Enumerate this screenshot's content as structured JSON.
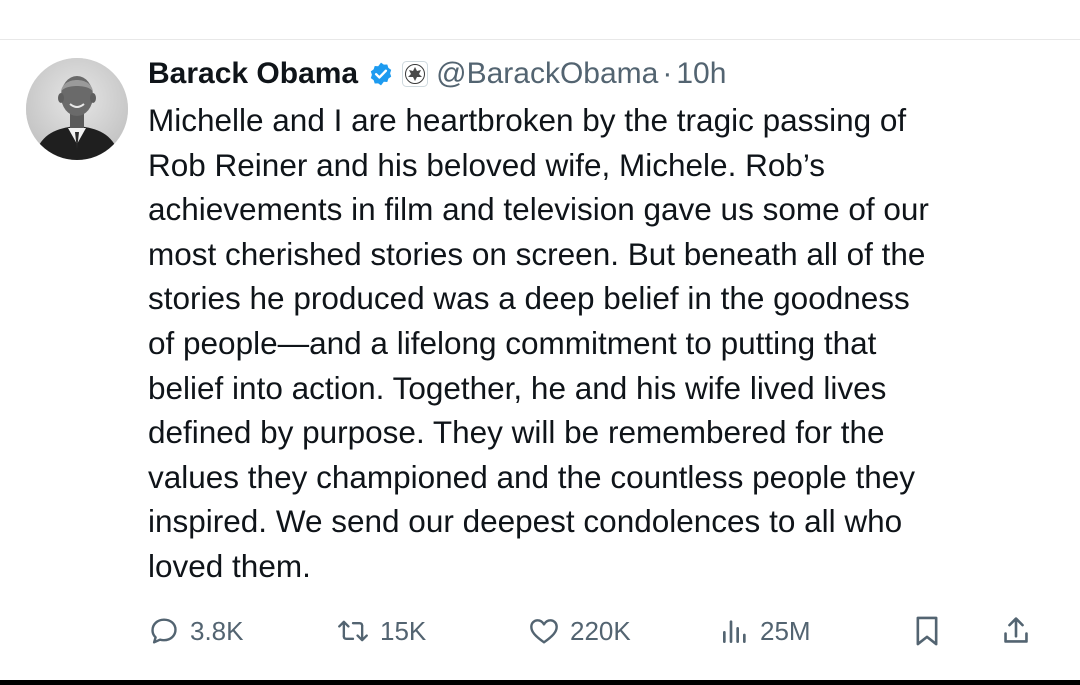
{
  "tweet": {
    "author": {
      "display_name": "Barack Obama",
      "handle": "@BarackObama",
      "verified_icon": "verified-badge-icon",
      "affiliation_icon": "government-seal-icon",
      "avatar": "profile-photo"
    },
    "separator": "·",
    "time": "10h",
    "text_lines": [
      "Michelle and I are heartbroken by the tragic passing of",
      "Rob Reiner and his beloved wife, Michele. Rob’s",
      "achievements in film and television gave us some of our",
      "most cherished stories on screen. But beneath all of the",
      "stories he produced was a deep belief in the goodness",
      "of people—and a lifelong commitment to putting that",
      "belief into action. Together, he and his wife lived lives",
      "defined by purpose. They will be remembered for the",
      "values they championed and the countless people they",
      "inspired. We send our deepest condolences to all who",
      "loved them."
    ],
    "actions": {
      "reply": {
        "icon": "reply-icon",
        "count": "3.8K"
      },
      "repost": {
        "icon": "repost-icon",
        "count": "15K"
      },
      "like": {
        "icon": "heart-icon",
        "count": "220K"
      },
      "views": {
        "icon": "views-icon",
        "count": "25M"
      },
      "bookmark": {
        "icon": "bookmark-icon"
      },
      "share": {
        "icon": "share-icon"
      }
    }
  },
  "colors": {
    "text_primary": "#0f1419",
    "text_secondary": "#536471",
    "verified_blue": "#1d9bf0"
  }
}
